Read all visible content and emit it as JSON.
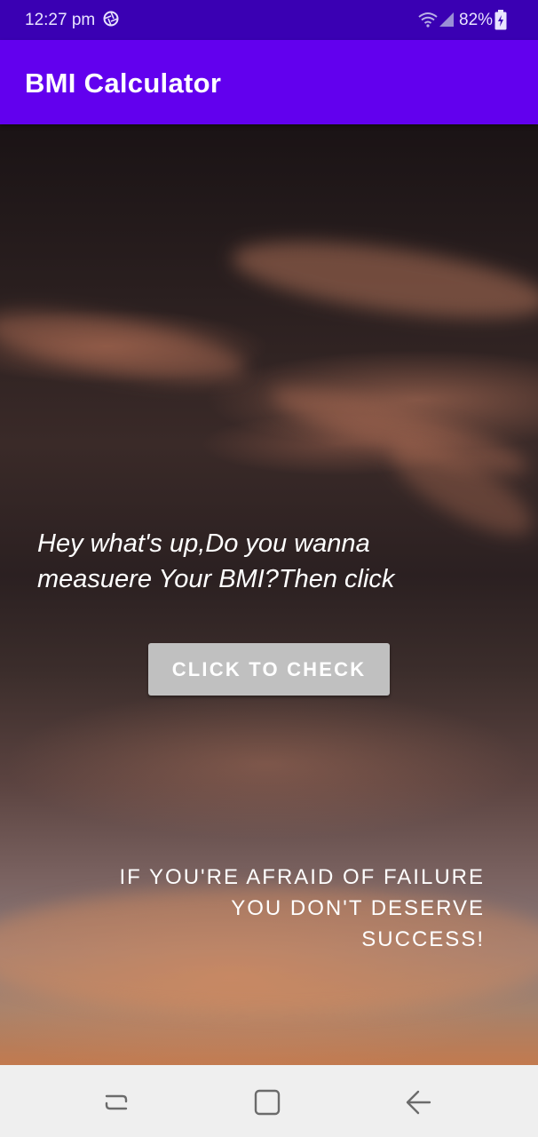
{
  "status_bar": {
    "time": "12:27 pm",
    "battery_percent": "82%",
    "icons": [
      "aperture-icon",
      "wifi-icon",
      "signal-icon",
      "battery-icon"
    ],
    "background_color": "#3a00b3"
  },
  "app_bar": {
    "title": "BMI Calculator",
    "background_color": "#6200ee"
  },
  "main": {
    "hint_line1": "Hey what's up,Do you wanna",
    "hint_line2": "measuere Your BMI?Then click",
    "check_button_label": "CLICK TO CHECK",
    "quote_line1": "IF YOU'RE AFRAID OF FAILURE",
    "quote_line2": "YOU DON'T DESERVE",
    "quote_line3": "SUCCESS!"
  },
  "nav_bar": {
    "buttons": [
      "recents-icon",
      "home-icon",
      "back-icon"
    ]
  }
}
